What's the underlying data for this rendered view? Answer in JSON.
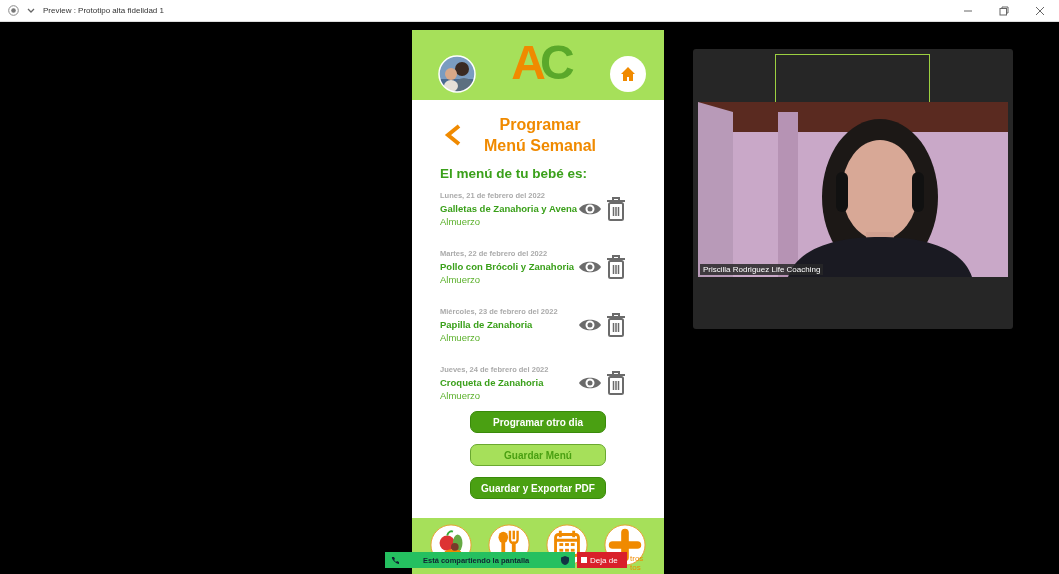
{
  "window": {
    "title": "Preview : Prototipo alta fidelidad 1"
  },
  "app": {
    "logo": [
      "A",
      "C"
    ],
    "title": [
      "Programar",
      "Menú Semanal"
    ],
    "subtitle": "El menú de tu bebé es:",
    "menu_items": [
      {
        "date": "Lunes, 21 de febrero del 2022",
        "dish": "Galletas de Zanahoria y Avena",
        "meal": "Almuerzo"
      },
      {
        "date": "Martes, 22 de febrero del 2022",
        "dish": "Pollo con Brócoli y Zanahoria",
        "meal": "Almuerzo"
      },
      {
        "date": "Miércoles, 23 de febrero del 2022",
        "dish": "Papilla de Zanahoria",
        "meal": "Almuerzo"
      },
      {
        "date": "Jueves, 24 de febrero del 2022",
        "dish": "Croqueta de Zanahoria",
        "meal": "Almuerzo"
      }
    ],
    "buttons": [
      {
        "label": "Programar otro dia",
        "kind": "primary"
      },
      {
        "label": "Guardar Menú",
        "kind": "secondary"
      },
      {
        "label": "Guardar y Exportar PDF",
        "kind": "primary"
      }
    ],
    "nav_caption": [
      "tros",
      "tos"
    ]
  },
  "video": {
    "name": "Priscilla Rodriguez Life Coaching"
  },
  "share_bar": {
    "text": "Está compartiendo la pantalla",
    "stop": "Deja de"
  }
}
